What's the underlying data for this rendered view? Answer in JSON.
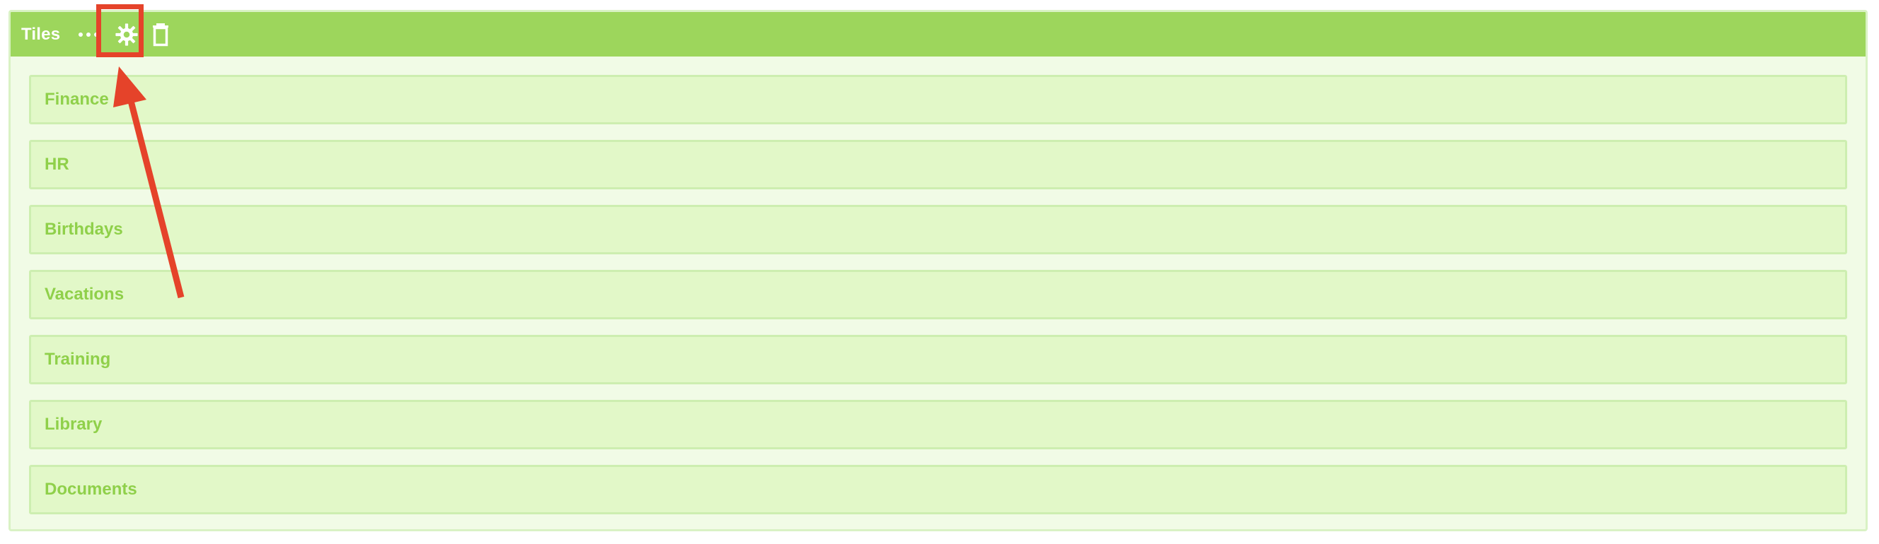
{
  "panel": {
    "title": "Tiles",
    "header_actions": {
      "more": "more-icon",
      "settings": "gear-icon",
      "delete": "trash-icon"
    }
  },
  "tiles": [
    {
      "label": "Finance"
    },
    {
      "label": "HR"
    },
    {
      "label": "Birthdays"
    },
    {
      "label": "Vacations"
    },
    {
      "label": "Training"
    },
    {
      "label": "Library"
    },
    {
      "label": "Documents"
    }
  ],
  "colors": {
    "header": "#9dd65c",
    "tile_bg": "#e2f8c8",
    "tile_text": "#8fd04a",
    "annotation": "#e5432a"
  }
}
